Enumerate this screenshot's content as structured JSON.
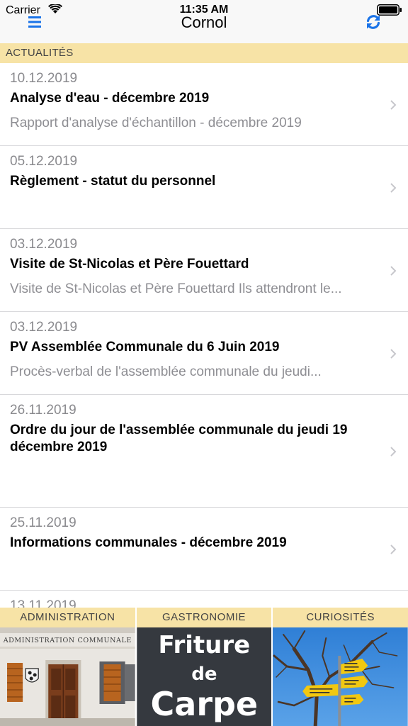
{
  "status_bar": {
    "carrier": "Carrier",
    "time": "11:35 AM"
  },
  "nav": {
    "title": "Cornol",
    "left_icon": "hamburger-menu-icon",
    "right_icon": "refresh-icon"
  },
  "colors": {
    "accent": "#1a73e8",
    "section_bg": "#f7e3a6",
    "tile_label_bg": "#f7e3a6"
  },
  "section": {
    "title": "ACTUALITÉS"
  },
  "news": [
    {
      "date": "10.12.2019",
      "title": "Analyse d'eau - décembre 2019",
      "subtitle": "Rapport d'analyse d'échantillon - décembre 2019"
    },
    {
      "date": "05.12.2019",
      "title": "Règlement - statut du personnel",
      "subtitle": ""
    },
    {
      "date": "03.12.2019",
      "title": "Visite de St-Nicolas et Père Fouettard",
      "subtitle": "Visite de St-Nicolas et Père Fouettard  Ils attendront le..."
    },
    {
      "date": "03.12.2019",
      "title": "PV Assemblée Communale du 6 Juin 2019",
      "subtitle": "Procès-verbal de l'assemblée communale du jeudi..."
    },
    {
      "date": "26.11.2019",
      "title": "Ordre du jour de l'assemblée communale du jeudi 19 décembre 2019",
      "subtitle": ""
    },
    {
      "date": "25.11.2019",
      "title": "Informations communales - décembre 2019",
      "subtitle": ""
    },
    {
      "date": "13.11.2019",
      "title": "",
      "subtitle": ""
    }
  ],
  "tiles": [
    {
      "label": "ADMINISTRATION",
      "image_text": "ADMINISTRATION  COMMUNALE"
    },
    {
      "label": "GASTRONOMIE",
      "image_text": [
        "Friture",
        "de",
        "Carpe"
      ]
    },
    {
      "label": "CURIOSITÉS"
    }
  ]
}
